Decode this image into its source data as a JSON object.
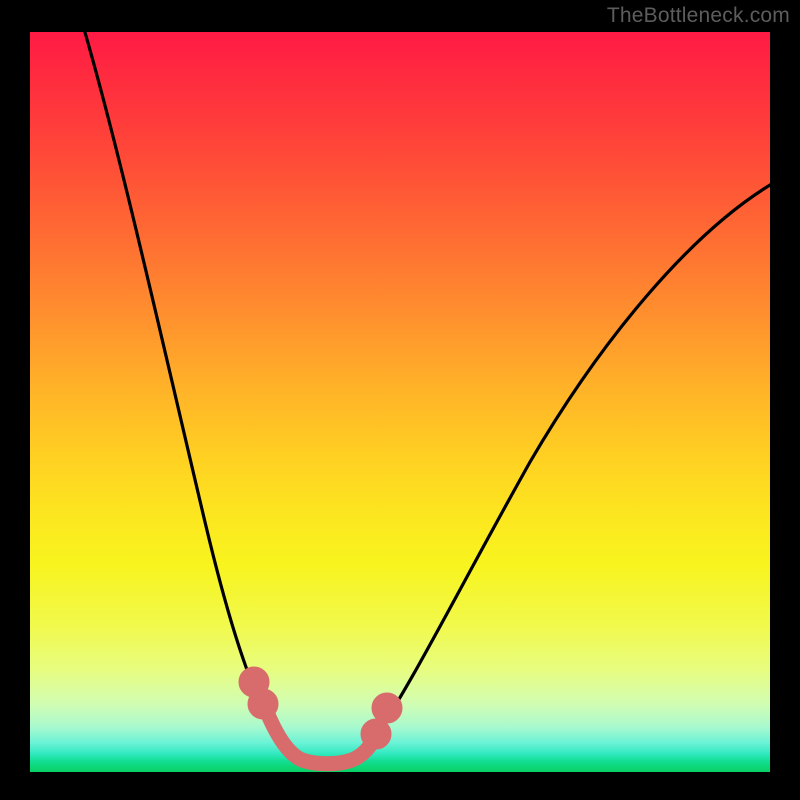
{
  "watermark": "TheBottleneck.com",
  "chart_data": {
    "type": "line",
    "title": "",
    "xlabel": "",
    "ylabel": "",
    "xlim": [
      0,
      100
    ],
    "ylim": [
      0,
      100
    ],
    "grid": false,
    "legend": false,
    "background_gradient": {
      "direction": "vertical",
      "stops": [
        {
          "pos": 0,
          "meaning": "worst",
          "color": "#ff1a45"
        },
        {
          "pos": 50,
          "meaning": "mid",
          "color": "#ffd222"
        },
        {
          "pos": 100,
          "meaning": "best",
          "color": "#0ad065"
        }
      ]
    },
    "series": [
      {
        "name": "bottleneck-curve",
        "color": "#000000",
        "x": [
          7,
          10,
          13,
          16,
          19,
          22,
          25,
          28,
          30,
          32,
          34,
          36,
          38,
          40,
          44,
          48,
          52,
          56,
          62,
          70,
          80,
          90,
          100
        ],
        "y": [
          100,
          90,
          79,
          68,
          57,
          46,
          36,
          26,
          18,
          12,
          7,
          4,
          2,
          1.5,
          1.5,
          3,
          7,
          14,
          25,
          40,
          56,
          68,
          78
        ]
      },
      {
        "name": "optimal-range-marker",
        "color": "#d86b6b",
        "style": "thick-dots",
        "x": [
          30,
          32,
          34,
          36,
          38,
          40,
          42,
          44,
          46,
          48
        ],
        "y": [
          12,
          6,
          3,
          2,
          1.5,
          1.5,
          1.5,
          2,
          3,
          7
        ]
      }
    ],
    "annotations": []
  }
}
